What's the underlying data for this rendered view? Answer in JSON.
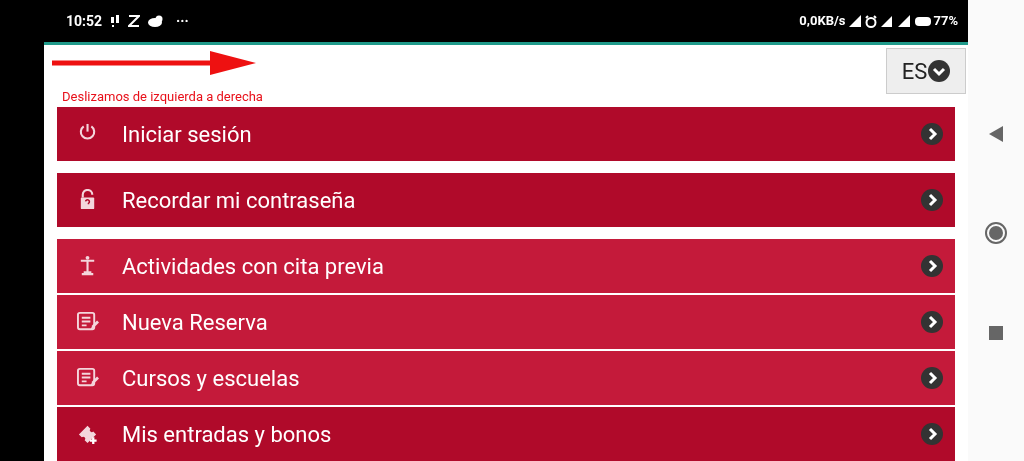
{
  "status_bar": {
    "time": "10:52",
    "more": "···",
    "speed": "0,0KB/s",
    "battery": "77%"
  },
  "hint": {
    "text": "Deslizamos de izquierda a derecha"
  },
  "language": {
    "label": "ES"
  },
  "menu_groups": [
    {
      "items": [
        {
          "kind": "power",
          "label": "Iniciar sesión",
          "color": "#b00a2a"
        }
      ]
    },
    {
      "items": [
        {
          "kind": "lock",
          "label": "Recordar mi contraseña",
          "color": "#b00a2a"
        }
      ]
    },
    {
      "items": [
        {
          "kind": "figure",
          "label": "Actividades con cita previa",
          "color": "#c41a3a"
        },
        {
          "kind": "list",
          "label": "Nueva Reserva",
          "color": "#c41a3a"
        },
        {
          "kind": "list",
          "label": "Cursos y escuelas",
          "color": "#c41a3a"
        },
        {
          "kind": "ticket",
          "label": "Mis entradas y bonos",
          "color": "#b00a2a"
        }
      ]
    }
  ]
}
